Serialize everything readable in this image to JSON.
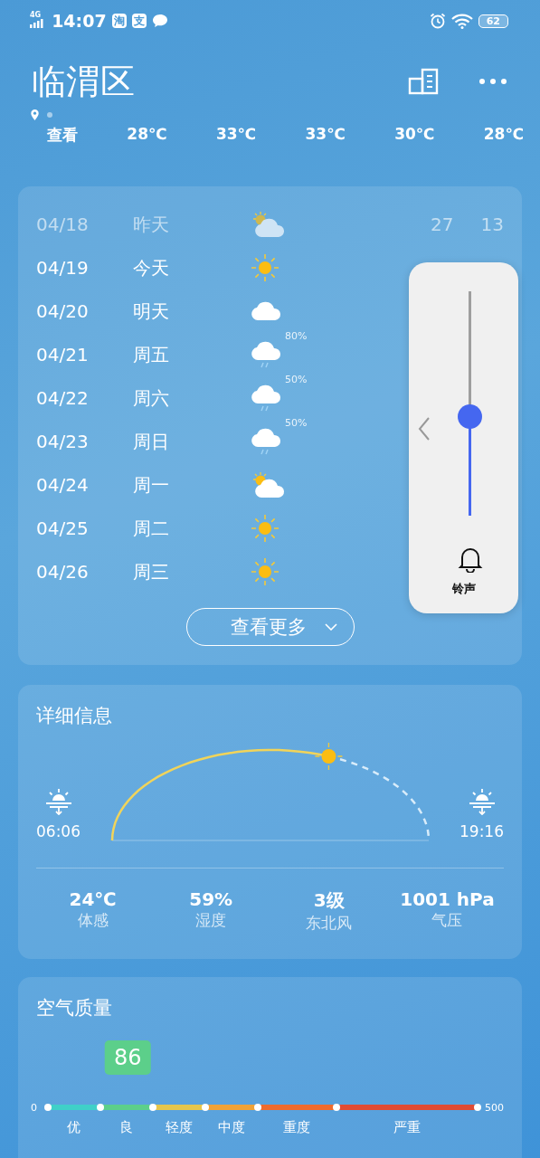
{
  "status_bar": {
    "network": "4G",
    "time": "14:07",
    "app_badges": [
      "淘",
      "支"
    ],
    "battery": "62"
  },
  "header": {
    "city": "临渭区",
    "strip": [
      "查看",
      "28℃",
      "33℃",
      "33℃",
      "30℃",
      "28℃"
    ]
  },
  "forecast": {
    "days": [
      {
        "date": "04/18",
        "day": "昨天",
        "kind": "partly",
        "past": true,
        "high": "27",
        "low": "13"
      },
      {
        "date": "04/19",
        "day": "今天",
        "kind": "sun",
        "past": false
      },
      {
        "date": "04/20",
        "day": "明天",
        "kind": "cloud",
        "past": false
      },
      {
        "date": "04/21",
        "day": "周五",
        "kind": "rain",
        "past": false,
        "chance": "80%"
      },
      {
        "date": "04/22",
        "day": "周六",
        "kind": "rain",
        "past": false,
        "chance": "50%"
      },
      {
        "date": "04/23",
        "day": "周日",
        "kind": "rain",
        "past": false,
        "chance": "50%"
      },
      {
        "date": "04/24",
        "day": "周一",
        "kind": "partly",
        "past": false
      },
      {
        "date": "04/25",
        "day": "周二",
        "kind": "sun",
        "past": false
      },
      {
        "date": "04/26",
        "day": "周三",
        "kind": "sun",
        "past": false
      }
    ],
    "more_button": "查看更多"
  },
  "details": {
    "title": "详细信息",
    "sunrise": "06:06",
    "sunset": "19:16",
    "level": 0.62,
    "items": [
      {
        "value": "24℃",
        "label": "体感"
      },
      {
        "value": "59%",
        "label": "湿度"
      },
      {
        "value": "3级",
        "label": "东北风"
      },
      {
        "value": "1001 hPa",
        "label": "气压"
      }
    ]
  },
  "air_quality": {
    "title": "空气质量",
    "value": "86",
    "level": 0.186,
    "min": "0",
    "max": "500",
    "segments": [
      {
        "label": "优",
        "color": "#3fd0c8"
      },
      {
        "label": "良",
        "color": "#5ccf8a"
      },
      {
        "label": "轻度",
        "color": "#e6c64c"
      },
      {
        "label": "中度",
        "color": "#f0a236"
      },
      {
        "label": "重度",
        "color": "#ef6b2d"
      },
      {
        "label": "严重",
        "color": "#e04b33"
      }
    ]
  },
  "volume_panel": {
    "level": 0.44,
    "label": "铃声"
  }
}
